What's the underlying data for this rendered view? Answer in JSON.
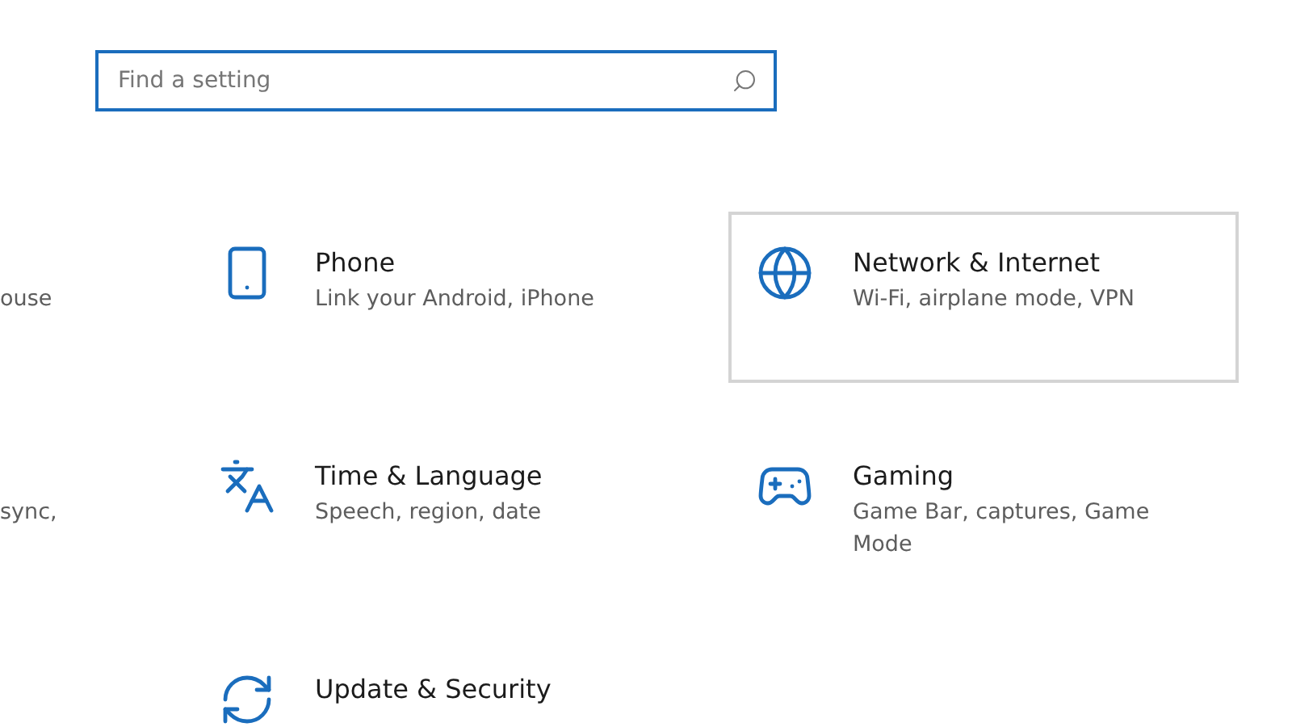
{
  "search": {
    "placeholder": "Find a setting"
  },
  "tiles": [
    {
      "kind": "partial",
      "description": "ouse",
      "highlighted": false
    },
    {
      "kind": "phone",
      "title": "Phone",
      "description": "Link your Android, iPhone",
      "highlighted": false
    },
    {
      "kind": "network",
      "title": "Network & Internet",
      "description": "Wi-Fi, airplane mode, VPN",
      "highlighted": true
    },
    {
      "kind": "partial",
      "description": "sync,",
      "highlighted": false
    },
    {
      "kind": "time",
      "title": "Time & Language",
      "description": "Speech, region, date",
      "highlighted": false
    },
    {
      "kind": "gaming",
      "title": "Gaming",
      "description": "Game Bar, captures, Game Mode",
      "highlighted": false
    },
    {
      "kind": "partial",
      "highlighted": false
    },
    {
      "kind": "update",
      "title": "Update & Security",
      "highlighted": false
    }
  ]
}
